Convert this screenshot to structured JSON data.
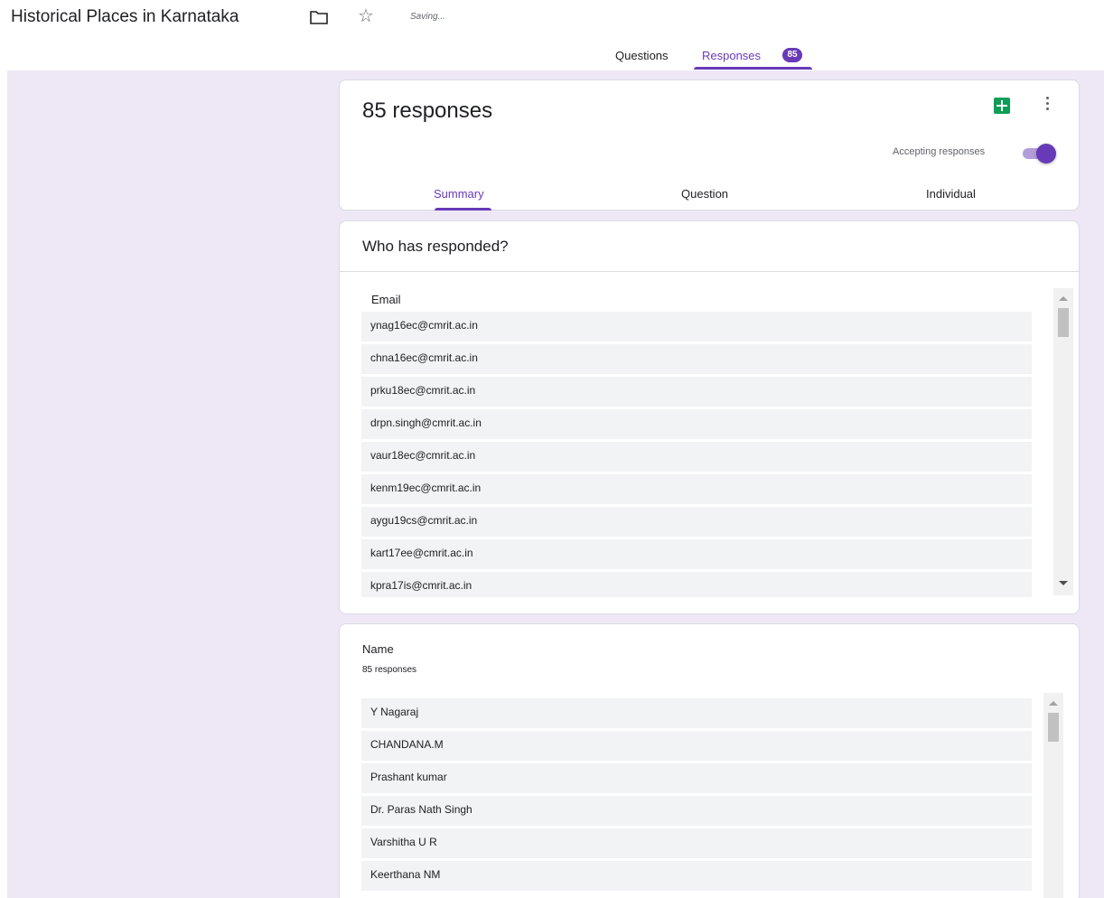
{
  "header": {
    "title": "Historical Places in Karnataka",
    "status": "Saving...",
    "folder_icon": "folder-icon",
    "star_icon": "star-icon"
  },
  "tabs": {
    "questions": "Questions",
    "responses": "Responses",
    "responses_badge": "85"
  },
  "summary": {
    "count_label": "85 responses",
    "accepting_label": "Accepting responses",
    "accepting": true,
    "subtabs": [
      "Summary",
      "Question",
      "Individual"
    ]
  },
  "who": {
    "title": "Who has responded?",
    "column_header": "Email",
    "emails": [
      "ynag16ec@cmrit.ac.in",
      "chna16ec@cmrit.ac.in",
      "prku18ec@cmrit.ac.in",
      "drpn.singh@cmrit.ac.in",
      "vaur18ec@cmrit.ac.in",
      "kenm19ec@cmrit.ac.in",
      "aygu19cs@cmrit.ac.in",
      "kart17ee@cmrit.ac.in",
      "kpra17is@cmrit.ac.in"
    ]
  },
  "name_question": {
    "title": "Name",
    "subtitle": "85 responses",
    "answers": [
      "Y Nagaraj",
      "CHANDANA.M",
      "Prashant kumar",
      "Dr. Paras Nath Singh",
      "Varshitha U R",
      "Keerthana NM"
    ]
  },
  "colors": {
    "accent": "#673ab7",
    "background": "#ede7f6",
    "sheets_green": "#0f9d58"
  }
}
